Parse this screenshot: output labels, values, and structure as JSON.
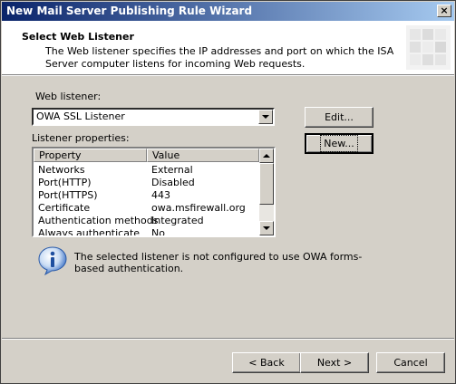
{
  "window": {
    "title": "New Mail Server Publishing Rule Wizard"
  },
  "header": {
    "title": "Select Web Listener",
    "description": "The Web listener specifies the IP addresses and port on which the ISA Server computer listens for incoming Web requests."
  },
  "web_listener": {
    "label": "Web listener:",
    "selected": "OWA SSL Listener"
  },
  "buttons": {
    "edit": "Edit...",
    "new": "New...",
    "back": "< Back",
    "next": "Next >",
    "cancel": "Cancel"
  },
  "listener_properties": {
    "label": "Listener properties:",
    "columns": [
      "Property",
      "Value"
    ],
    "rows": [
      {
        "property": "Networks",
        "value": "External"
      },
      {
        "property": "Port(HTTP)",
        "value": "Disabled"
      },
      {
        "property": "Port(HTTPS)",
        "value": "443"
      },
      {
        "property": "Certificate",
        "value": "owa.msfirewall.org"
      },
      {
        "property": "Authentication methods",
        "value": "Integrated"
      },
      {
        "property": "Always authenticate",
        "value": "No"
      }
    ]
  },
  "info": {
    "icon": "info-icon",
    "message": "The selected listener is not configured to use OWA forms-based authentication."
  }
}
